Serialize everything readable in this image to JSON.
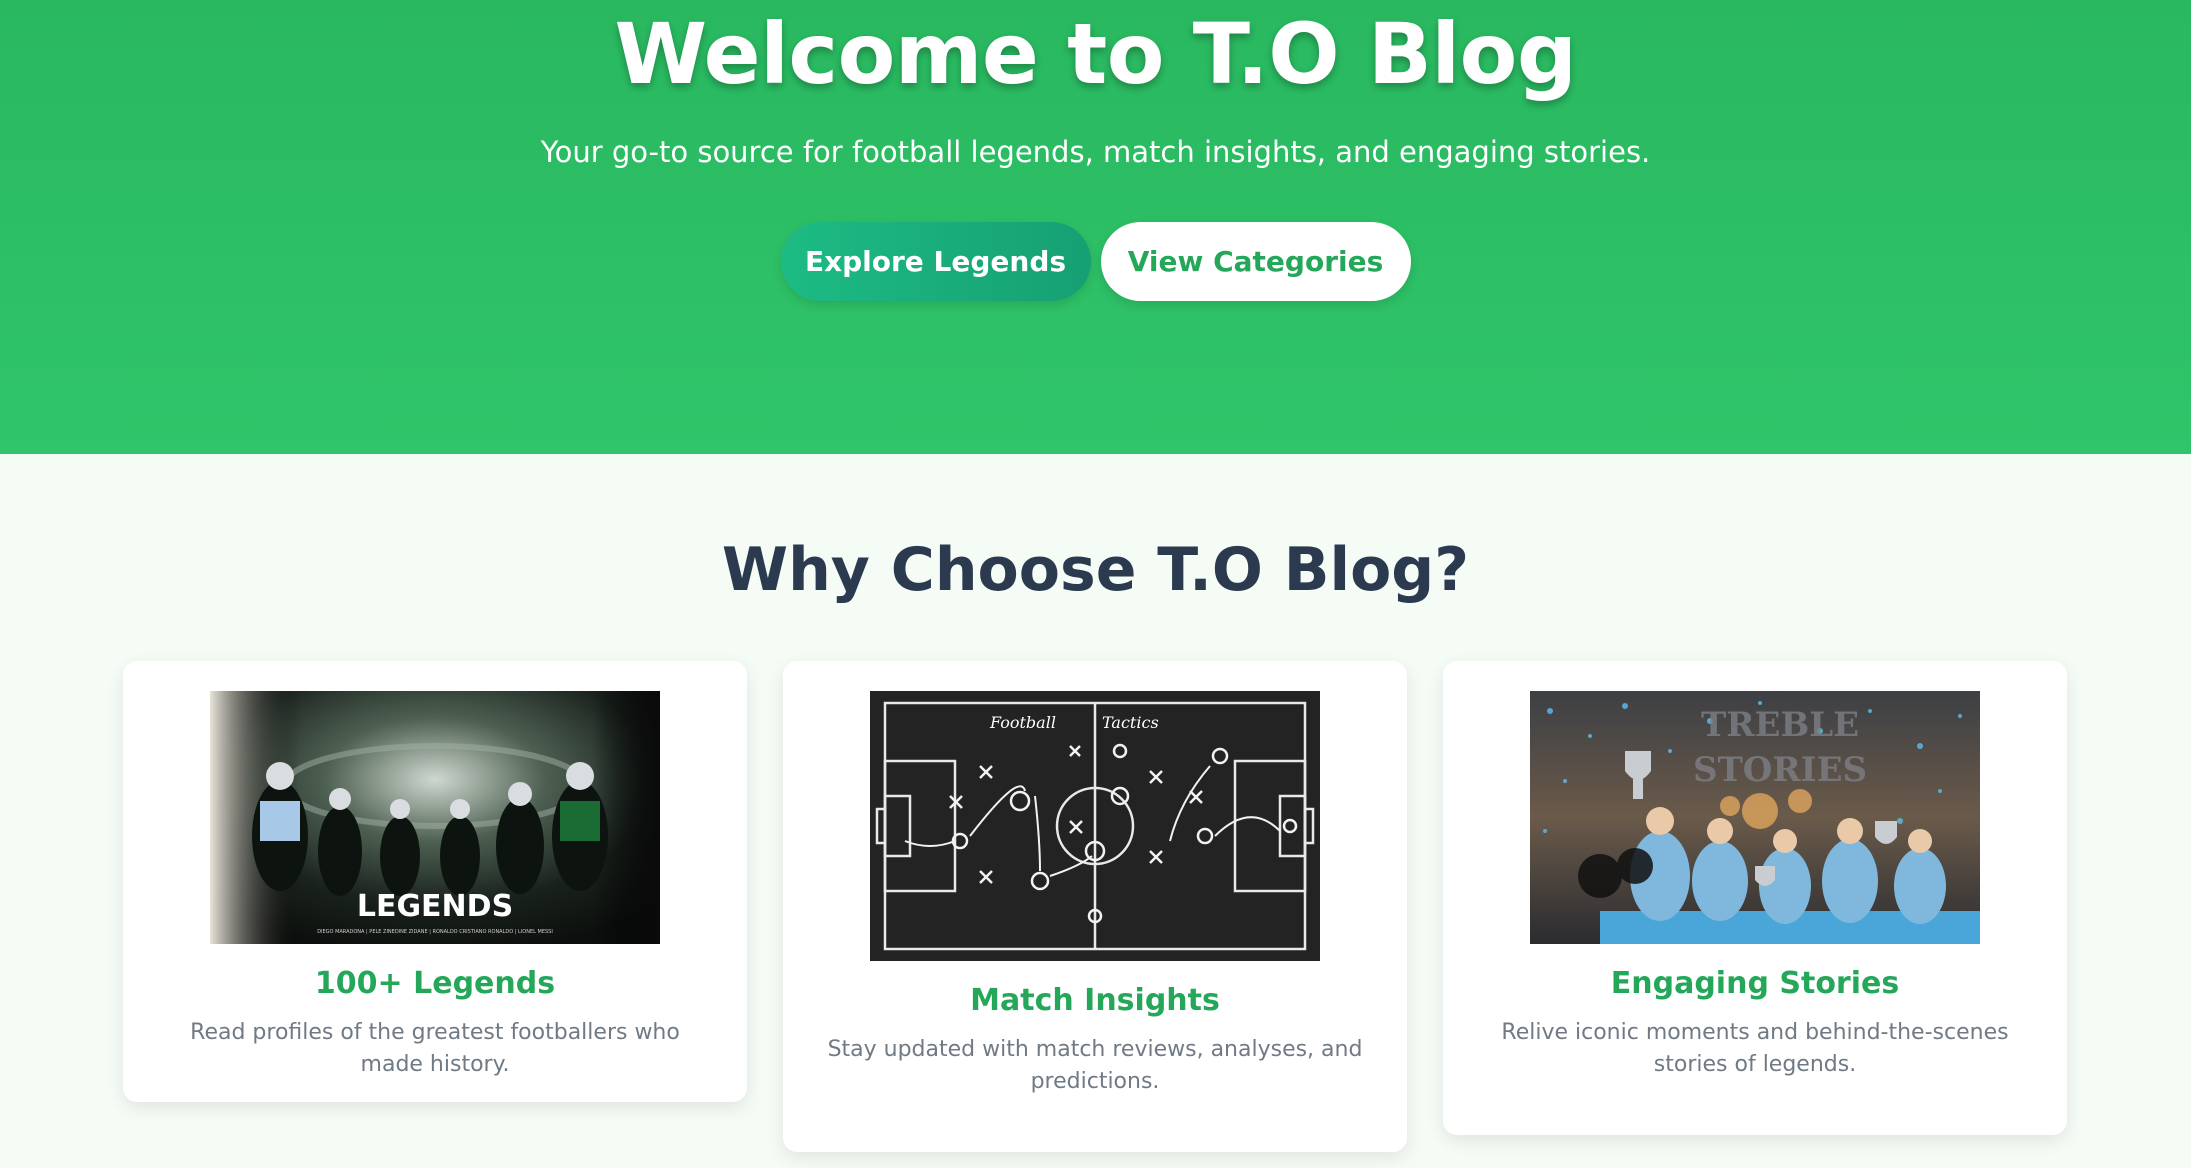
{
  "hero": {
    "title": "Welcome to T.O Blog",
    "subtitle": "Your go-to source for football legends, match insights, and engaging stories.",
    "primary_button": "Explore Legends",
    "secondary_button": "View Categories"
  },
  "features": {
    "heading": "Why Choose T.O Blog?",
    "cards": [
      {
        "title": "100+ Legends",
        "description": "Read profiles of the greatest footballers who made history.",
        "image_text": "LEGENDS",
        "image_caption": "DIEGO MARADONA | PELE  ZINEDINE ZIDANE | RONALDO  CRISTIANO RONALDO | LIONEL MESSI"
      },
      {
        "title": "Match Insights",
        "description": "Stay updated with match reviews, analyses, and predictions.",
        "image_text_left": "Football",
        "image_text_right": "Tactics"
      },
      {
        "title": "Engaging Stories",
        "description": "Relive iconic moments and behind-the-scenes stories of legends.",
        "image_text_1": "TREBLE",
        "image_text_2": "STORIES"
      }
    ]
  },
  "colors": {
    "hero_green": "#2fc36a",
    "accent_green": "#25a75a",
    "heading_dark": "#2b3a4f",
    "page_bg": "#f5fbf5"
  }
}
